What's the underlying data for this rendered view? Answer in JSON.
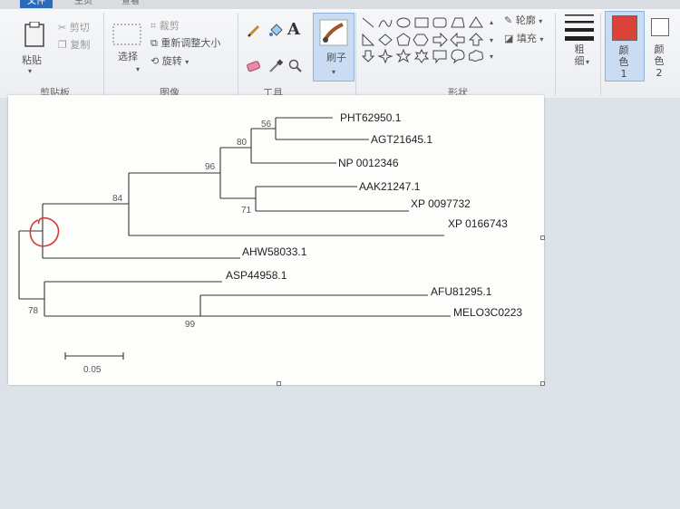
{
  "tabs": [
    "文件",
    "主页",
    "查看"
  ],
  "clipboard": {
    "paste": "粘贴",
    "cut": "剪切",
    "copy": "复制",
    "group": "剪贴板"
  },
  "image": {
    "select": "选择",
    "crop": "裁剪",
    "resize": "重新调整大小",
    "rotate": "旋转",
    "group": "图像"
  },
  "tools": {
    "group": "工具"
  },
  "brushes": {
    "label": "刷子"
  },
  "shapes": {
    "outline": "轮廓",
    "fill": "填充",
    "group": "形状"
  },
  "size": {
    "label": "粗细"
  },
  "colors": {
    "color1": "颜色 1",
    "color2": "颜色 2",
    "color1_hex": "#d9433a",
    "color2_hex": "#ffffff"
  },
  "tree": {
    "leaves": [
      "PHT62950.1",
      "AGT21645.1",
      "NP 0012346",
      "AAK21247.1",
      "XP 0097732",
      "XP 0166743",
      "AHW58033.1",
      "ASP44958.1",
      "AFU81295.1",
      "MELO3C0223"
    ],
    "bootstrap": [
      "56",
      "80",
      "96",
      "71",
      "84",
      "78",
      "99"
    ],
    "scale": "0.05"
  }
}
